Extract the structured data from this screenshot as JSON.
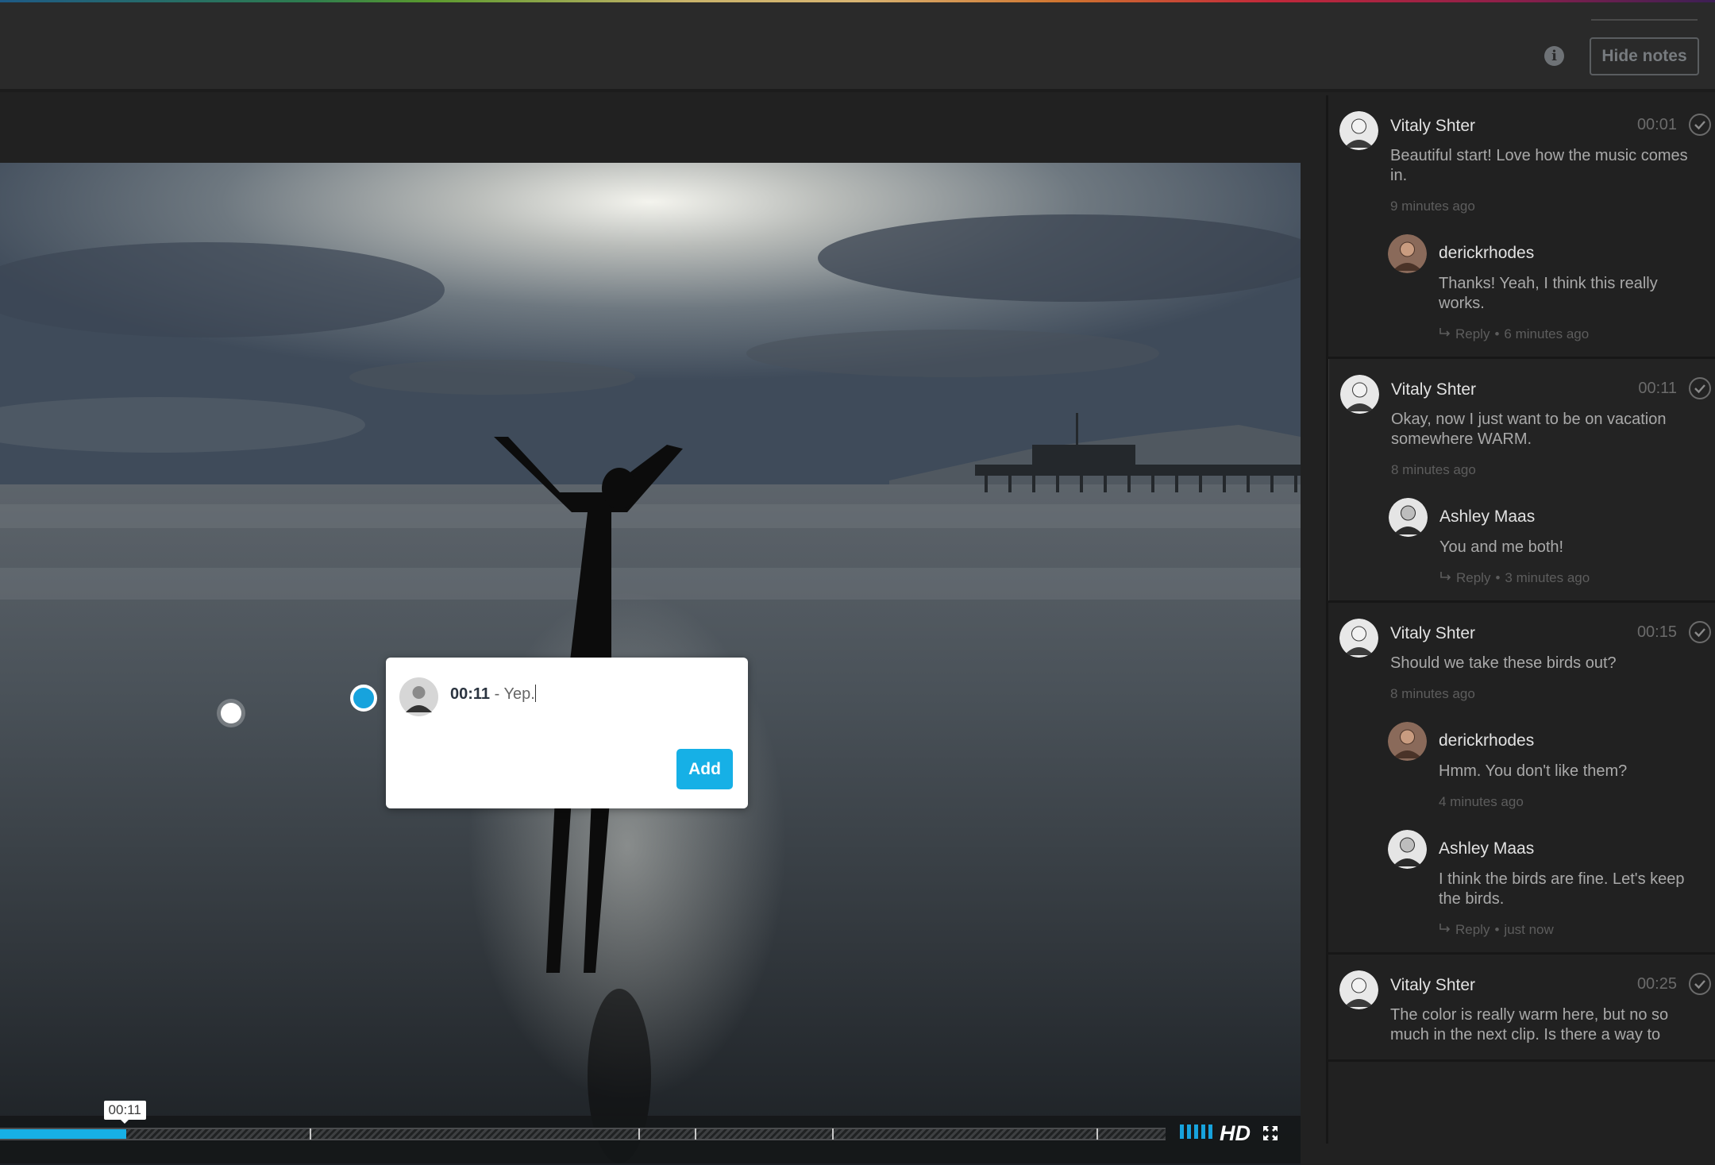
{
  "header": {
    "info_icon": "info-icon",
    "hide_notes_label": "Hide notes"
  },
  "player": {
    "current_time": "00:11",
    "progress_fraction": 0.108,
    "marker_fractions": [
      0.266,
      0.548,
      0.596,
      0.714,
      0.941
    ],
    "volume_bars": 5,
    "quality_label": "HD",
    "fullscreen_icon": "fullscreen-icon",
    "colors": {
      "accent": "#17b0e6"
    }
  },
  "note_popup": {
    "timestamp": "00:11",
    "separator": " - ",
    "text": "Yep.",
    "add_label": "Add"
  },
  "threads": [
    {
      "author": "Vitaly Shter",
      "time": "00:01",
      "text": "Beautiful start! Love how the music comes in.",
      "ago": "9 minutes ago",
      "active": false,
      "replies": [
        {
          "author": "derickrhodes",
          "text": "Thanks! Yeah, I think this really works.",
          "reply_label": "Reply",
          "ago": "6 minutes ago",
          "show_reply": true
        }
      ]
    },
    {
      "author": "Vitaly Shter",
      "time": "00:11",
      "text": "Okay, now I just want to be on vacation somewhere WARM.",
      "ago": "8 minutes ago",
      "active": true,
      "replies": [
        {
          "author": "Ashley Maas",
          "text": "You and me both!",
          "reply_label": "Reply",
          "ago": "3 minutes ago",
          "show_reply": true
        }
      ]
    },
    {
      "author": "Vitaly Shter",
      "time": "00:15",
      "text": "Should we take these birds out?",
      "ago": "8 minutes ago",
      "active": false,
      "replies": [
        {
          "author": "derickrhodes",
          "text": "Hmm. You don't like them?",
          "reply_label": "",
          "ago": "4 minutes ago",
          "show_reply": false
        },
        {
          "author": "Ashley Maas",
          "text": "I think the birds are fine. Let's keep the birds.",
          "reply_label": "Reply",
          "ago": "just now",
          "show_reply": true
        }
      ]
    },
    {
      "author": "Vitaly Shter",
      "time": "00:25",
      "text": "The color is really warm here, but no so much in the next clip. Is there a way to",
      "ago": "",
      "active": false,
      "replies": []
    }
  ]
}
